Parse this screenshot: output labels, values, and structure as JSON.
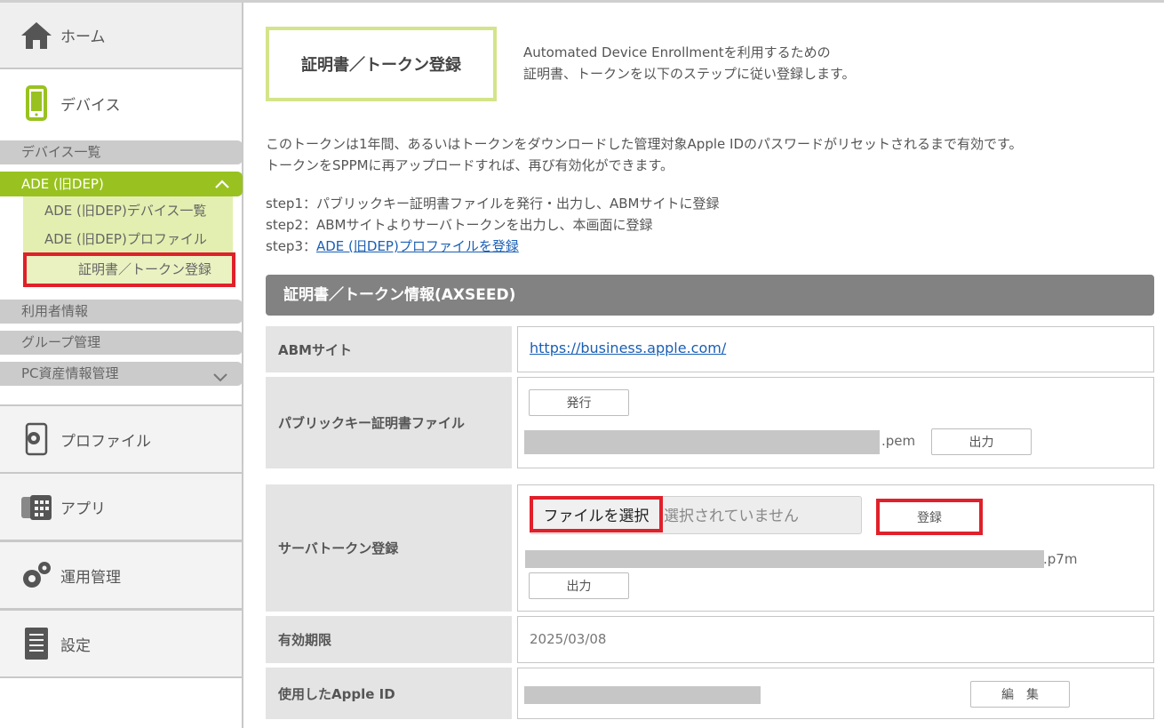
{
  "sidebar": {
    "home_label": "ホーム",
    "device_label": "デバイス",
    "device_list": "デバイス一覧",
    "ade_label": "ADE (旧DEP)",
    "ade_sub": [
      "ADE (旧DEP)デバイス一覧",
      "ADE (旧DEP)プロファイル",
      "証明書／トークン登録"
    ],
    "users": "利用者情報",
    "groups": "グループ管理",
    "pc_assets": "PC資産情報管理",
    "profile": "プロファイル",
    "apps": "アプリ",
    "operations": "運用管理",
    "settings": "設定"
  },
  "header": {
    "title": "証明書／トークン登録",
    "intro_line1": "Automated Device Enrollmentを利用するための",
    "intro_line2": "証明書、トークンを以下のステップに従い登録します。"
  },
  "description": {
    "line1": "このトークンは1年間、あるいはトークンをダウンロードした管理対象Apple IDのパスワードがリセットされるまで有効です。",
    "line2": "トークンをSPPMに再アップロードすれば、再び有効化ができます。"
  },
  "steps": {
    "step1": "step1：パブリックキー証明書ファイルを発行・出力し、ABMサイトに登録",
    "step2": "step2：ABMサイトよりサーバトークンを出力し、本画面に登録",
    "step3_prefix": "step3：",
    "step3_link": "ADE (旧DEP)プロファイルを登録"
  },
  "section": {
    "title": "証明書／トークン情報(AXSEED)"
  },
  "rows": {
    "abm_label": "ABMサイト",
    "abm_url": "https://business.apple.com/",
    "pubkey_label": "パブリックキー証明書ファイル",
    "issue_button": "発行",
    "pem_suffix": ".pem",
    "output_button": "出力",
    "token_label": "サーバトークン登録",
    "choose_file": "ファイルを選択",
    "no_file": "選択されていません",
    "register_button": "登録",
    "p7m_suffix": ".p7m",
    "output_button2": "出力",
    "expiry_label": "有効期限",
    "expiry_value": "2025/03/08",
    "appleid_label": "使用したApple ID",
    "edit_button": "編　集"
  },
  "colors": {
    "accent_green": "#99c220",
    "highlight_red": "#e0202a",
    "link_blue": "#1a5fb4"
  }
}
